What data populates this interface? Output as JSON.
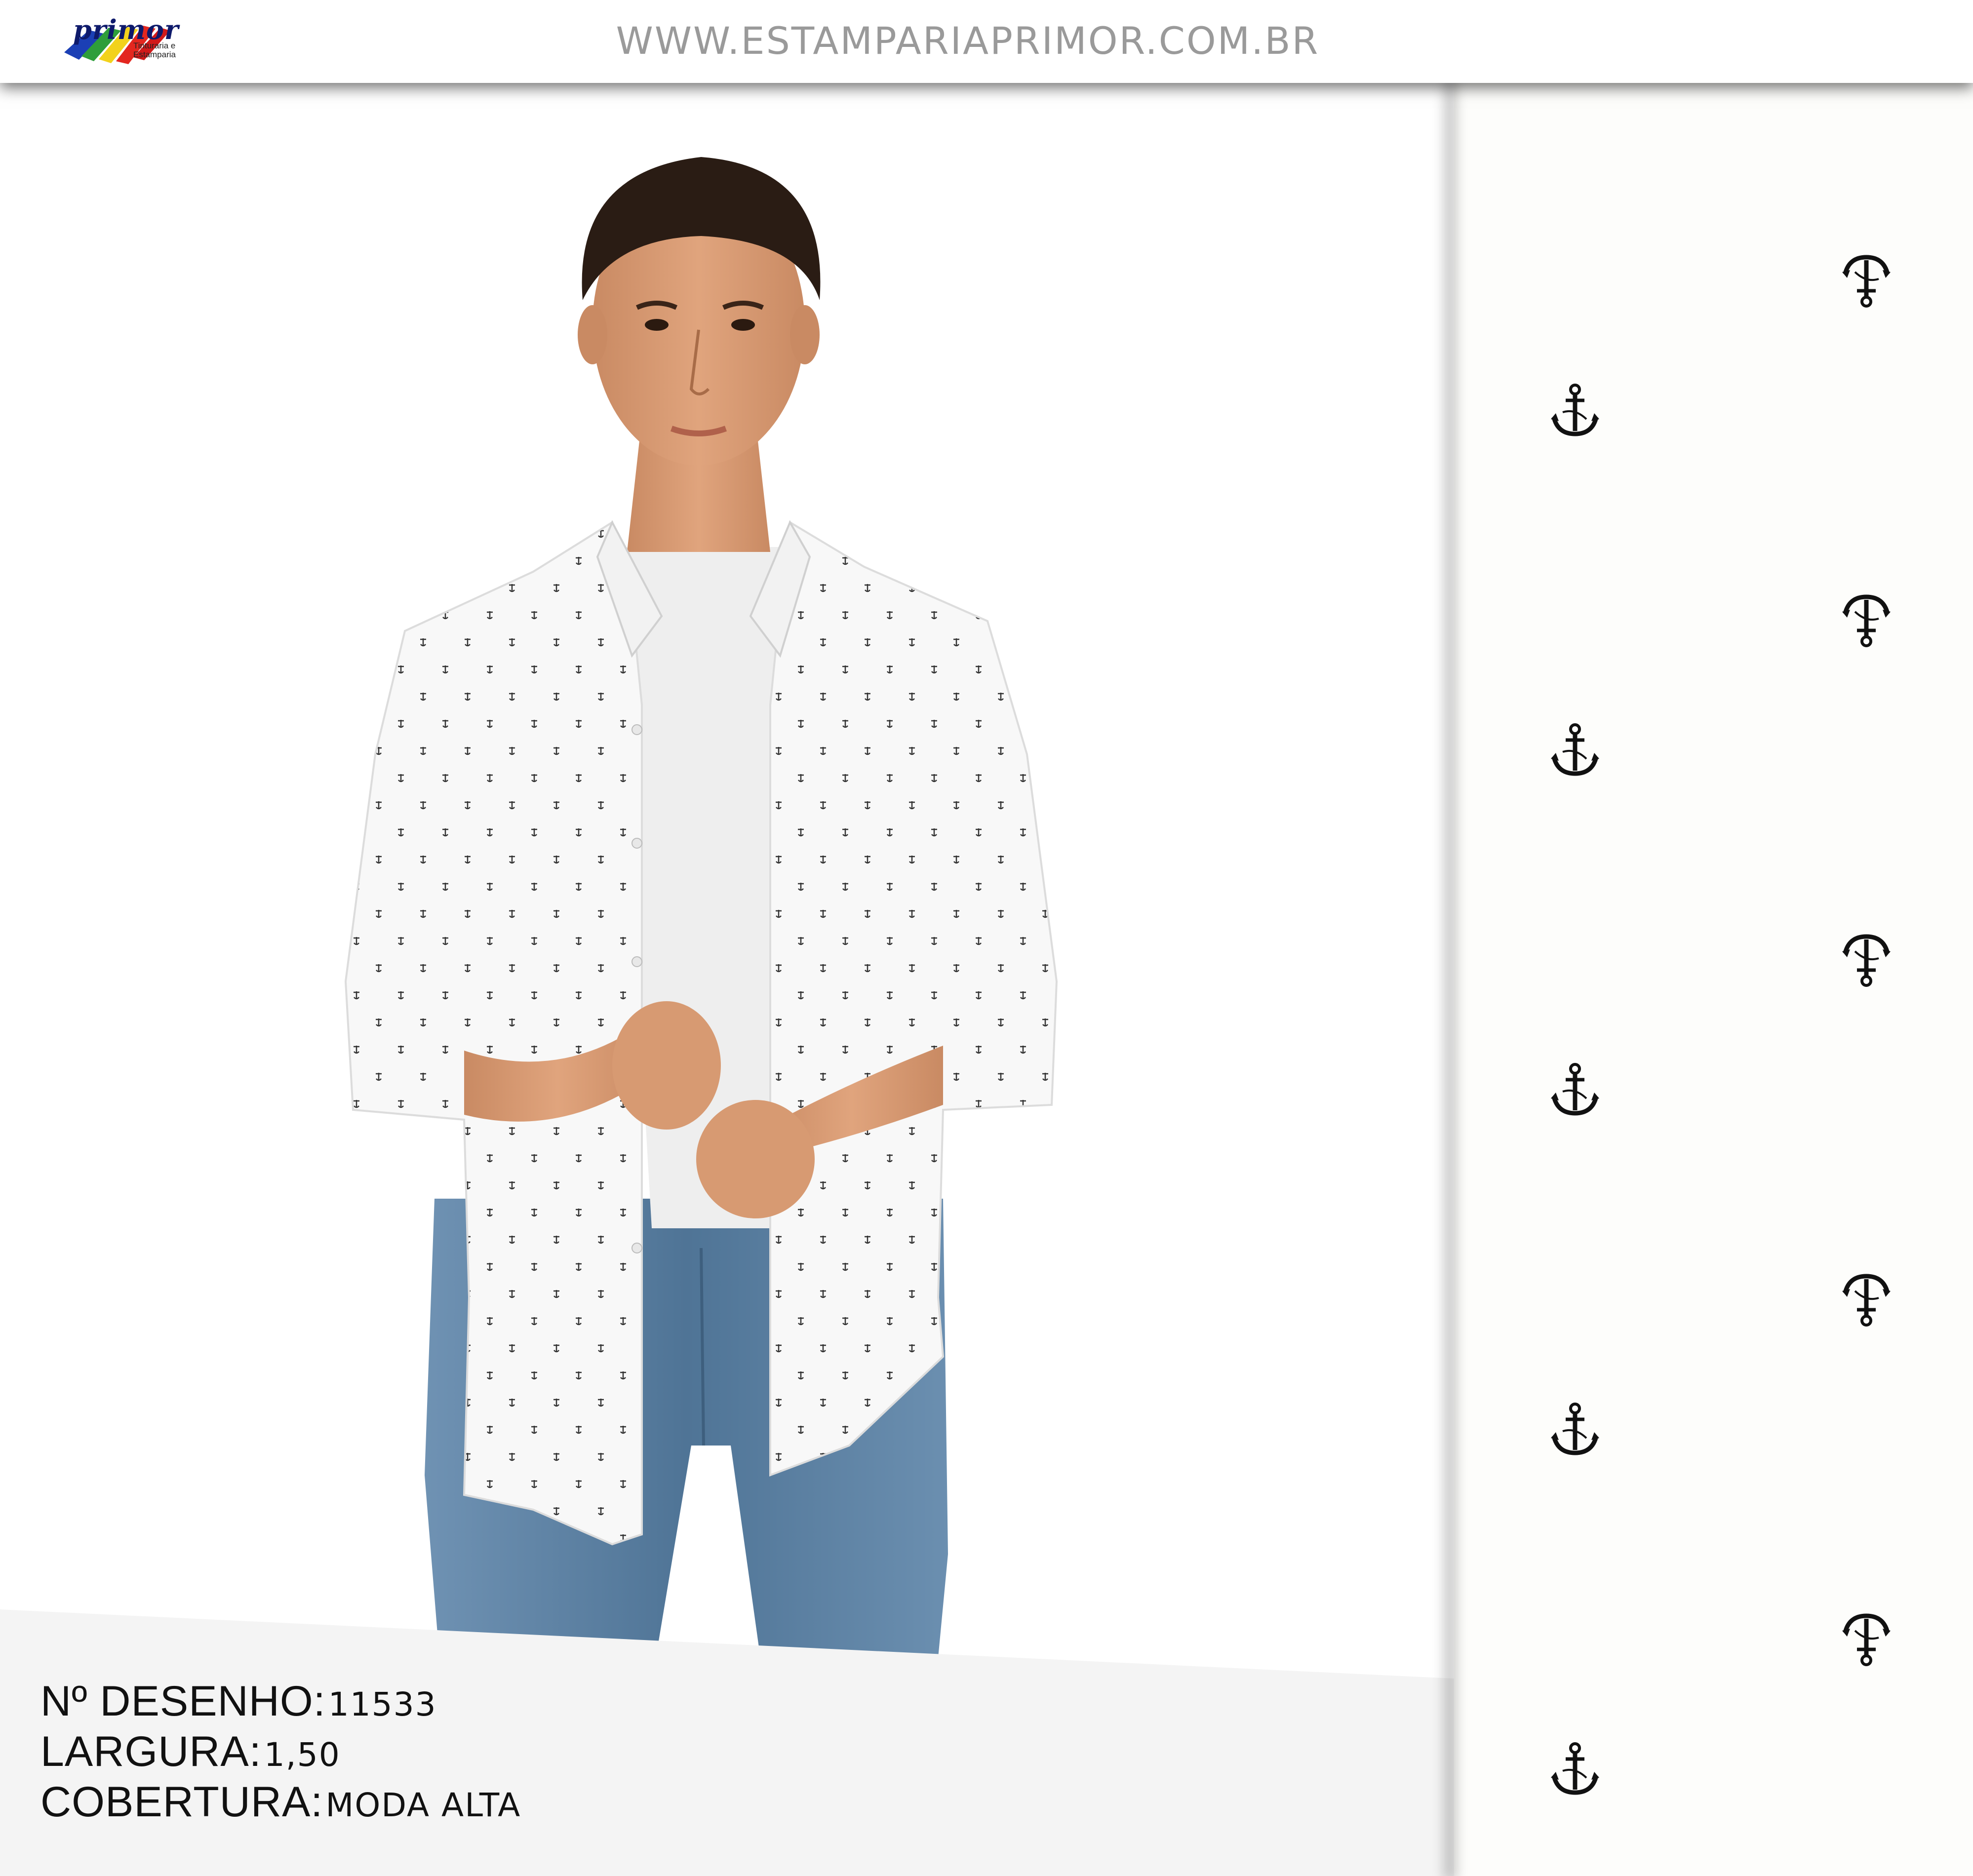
{
  "header": {
    "logo_text": "primor",
    "logo_subtext": "Tinturaria e Estamparia",
    "site_url": "WWW.ESTAMPARIAPRIMOR.COM.BR"
  },
  "info": {
    "design_number_label": "Nº DESENHO:",
    "design_number_value": "11533",
    "width_label": "LARGURA:",
    "width_value": "1,50",
    "coverage_label": "COBERTURA:",
    "coverage_value": "MODA ALTA"
  },
  "pattern": {
    "motif_icon": "anchor-icon",
    "repeat_count": 10
  },
  "colors": {
    "url_text": "#9a9a9a",
    "info_bg": "#f4f4f4",
    "motif": "#111111",
    "shirt": "#f7f7f7",
    "jeans": "#5a7fa0"
  }
}
